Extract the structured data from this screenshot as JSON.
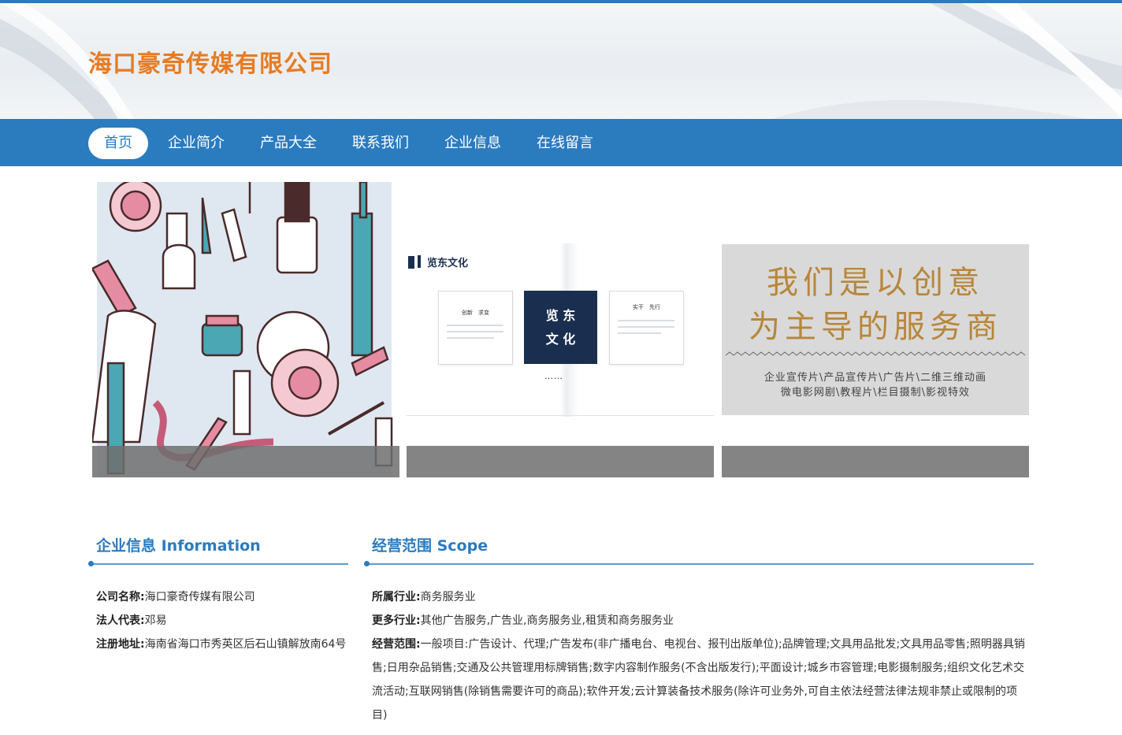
{
  "site": {
    "title": "海口豪奇传媒有限公司"
  },
  "nav": {
    "items": [
      {
        "label": "首页"
      },
      {
        "label": "企业简介"
      },
      {
        "label": "产品大全"
      },
      {
        "label": "联系我们"
      },
      {
        "label": "企业信息"
      },
      {
        "label": "在线留言"
      }
    ],
    "active_index": 0
  },
  "banners": {
    "culture": {
      "heading": "览东文化",
      "center_lines": [
        "览 东",
        "文 化"
      ],
      "left_card": {
        "title": "创新　求变"
      },
      "right_card": {
        "title": "实干　先行"
      },
      "dots": "……"
    },
    "slogan": {
      "line1": "我们是以创意",
      "line2": "为主导的服务商",
      "sub1": "企业宣传片\\产品宣传片\\广告片\\二维三维动画",
      "sub2": "微电影网剧\\教程片\\栏目摄制\\影视特效"
    }
  },
  "info": {
    "title": "企业信息 Information",
    "rows": [
      {
        "label": "公司名称:",
        "value": "海口豪奇传媒有限公司"
      },
      {
        "label": "法人代表:",
        "value": "邓易"
      },
      {
        "label": "注册地址:",
        "value": "海南省海口市秀英区后石山镇解放南64号"
      }
    ]
  },
  "scope": {
    "title": "经营范围 Scope",
    "rows": [
      {
        "label": "所属行业:",
        "value": "商务服务业"
      },
      {
        "label": "更多行业:",
        "value": "其他广告服务,广告业,商务服务业,租赁和商务服务业"
      },
      {
        "label": "经营范围:",
        "value": "一般项目:广告设计、代理;广告发布(非广播电台、电视台、报刊出版单位);品牌管理;文具用品批发;文具用品零售;照明器具销售;日用杂品销售;交通及公共管理用标牌销售;数字内容制作服务(不含出版发行);平面设计;城乡市容管理;电影摄制服务;组织文化艺术交流活动;互联网销售(除销售需要许可的商品);软件开发;云计算装备技术服务(除许可业务外,可自主依法经营法律法规非禁止或限制的项目)"
      }
    ]
  },
  "colors": {
    "brand_blue": "#2b7bbf",
    "title_orange": "#e87b21",
    "slogan_gold": "#b8863b"
  }
}
